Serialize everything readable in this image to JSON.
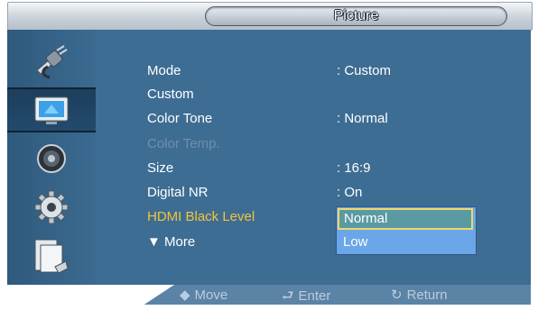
{
  "window": {
    "title": "Picture"
  },
  "sidebar": {
    "items": [
      {
        "icon": "input-plug-icon",
        "selected": false
      },
      {
        "icon": "picture-icon",
        "selected": true
      },
      {
        "icon": "sound-speaker-icon",
        "selected": false
      },
      {
        "icon": "setup-gear-icon",
        "selected": false
      },
      {
        "icon": "multi-screen-icon",
        "selected": false
      }
    ]
  },
  "menu": {
    "rows": [
      {
        "label": "Mode",
        "value": ": Custom",
        "state": "normal"
      },
      {
        "label": "Custom",
        "value": "",
        "state": "normal"
      },
      {
        "label": "Color Tone",
        "value": ": Normal",
        "state": "normal"
      },
      {
        "label": "Color Temp.",
        "value": "",
        "state": "disabled"
      },
      {
        "label": "Size",
        "value": ": 16:9",
        "state": "normal"
      },
      {
        "label": "Digital NR",
        "value": ": On",
        "state": "normal"
      },
      {
        "label": "HDMI Black Level",
        "value": ":",
        "state": "active"
      },
      {
        "label": "▼ More",
        "value": "",
        "state": "normal"
      }
    ]
  },
  "dropdown": {
    "options": [
      "Normal",
      "Low"
    ],
    "selected": "Normal"
  },
  "footer": {
    "move_icon": "◆",
    "move_label": "Move",
    "enter_icon": "⮐",
    "enter_label": "Enter",
    "return_icon": "↻",
    "return_label": "Return"
  },
  "colors": {
    "panel": "#3e6d94",
    "highlight_text": "#f3c43a",
    "dropdown": "#6aa6e8",
    "dropdown_selected": "#5a9aa2"
  }
}
